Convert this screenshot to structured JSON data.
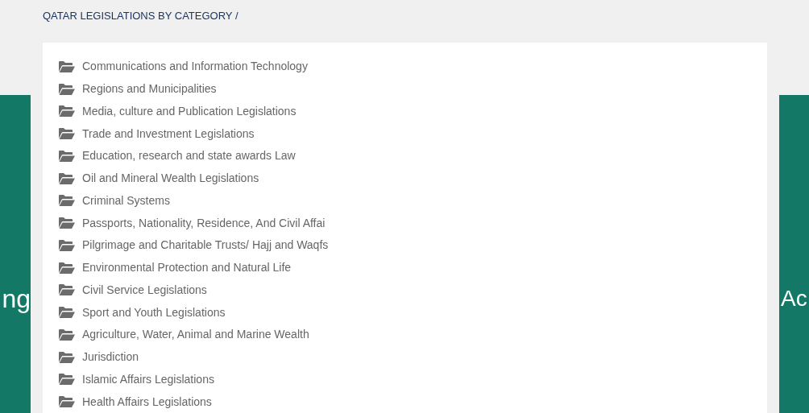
{
  "breadcrumb": "QATAR LEGISLATIONS BY CATEGORY /",
  "left_panel_text": "ng",
  "right_panel_text": "Ac",
  "categories": [
    "Communications and Information Technology",
    "Regions and Municipalities",
    "Media, culture and Publication Legislations",
    "Trade and Investment Legislations",
    "Education, research and state awards Law",
    "Oil and Mineral Wealth Legislations",
    "Criminal Systems",
    "Passports, Nationality, Residence, And Civil Affai",
    "Pilgrimage and Charitable Trusts/ Hajj and Waqfs",
    "Environmental Protection and Natural Life",
    "Civil Service Legislations",
    "Sport and Youth Legislations",
    "Agriculture, Water, Animal and Marine Wealth",
    "Jurisdiction",
    "Islamic Affairs Legislations",
    "Health Affairs Legislations"
  ]
}
